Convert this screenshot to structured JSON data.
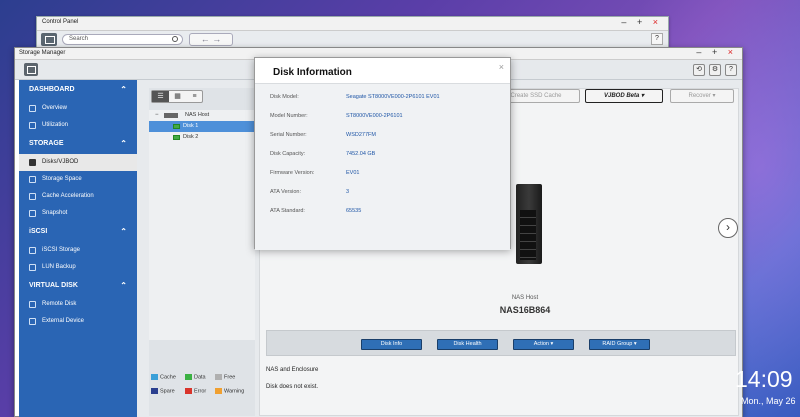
{
  "control_panel": {
    "title": "Control Panel",
    "window_controls": [
      "–",
      "+",
      "×"
    ],
    "search_placeholder": "Search",
    "nav_label": "←  →",
    "help_label": "?"
  },
  "storage_manager": {
    "title": "Storage Manager",
    "window_controls": [
      "–",
      "+",
      "×"
    ],
    "toolbar_buttons": [
      "⟲",
      "⚙",
      "?"
    ]
  },
  "sidebar": {
    "sections": [
      {
        "label": "DASHBOARD",
        "items": [
          "Overview",
          "Utilization"
        ]
      },
      {
        "label": "STORAGE",
        "items": [
          "Disks/VJBOD",
          "Storage Space",
          "Cache Acceleration",
          "Snapshot"
        ]
      },
      {
        "label": "iSCSI",
        "items": [
          "iSCSI Storage",
          "LUN Backup"
        ]
      },
      {
        "label": "VIRTUAL DISK",
        "items": [
          "Remote Disk",
          "External Device"
        ]
      }
    ],
    "active_item": "Disks/VJBOD",
    "chevron": "⌃"
  },
  "tree": {
    "view_buttons": [
      "☰",
      "▦",
      "≡"
    ],
    "host_label": "NAS Host",
    "disks": [
      "Disk 1",
      "Disk 2"
    ],
    "selected": "Disk 1",
    "expander": "−"
  },
  "legend": [
    {
      "label": "Cache",
      "color": "#3aa0d8"
    },
    {
      "label": "Data",
      "color": "#3bb143"
    },
    {
      "label": "Free",
      "color": "#b0b0b0"
    },
    {
      "label": "Spare",
      "color": "#2a3f8f"
    },
    {
      "label": "Error",
      "color": "#d9342b"
    },
    {
      "label": "Warning",
      "color": "#f0a030"
    }
  ],
  "top_buttons": {
    "ssd_cache": "Create SSD Cache",
    "vjbod": "VJBOD Beta ▾",
    "recover": "Recover ▾"
  },
  "nas": {
    "host_label": "NAS Host",
    "model": "NAS16B864",
    "next": "›"
  },
  "actions": [
    "Disk Info",
    "Disk Health",
    "Action ▾",
    "RAID Group ▾"
  ],
  "info": {
    "heading": "NAS and Enclosure",
    "message": "Disk does not exist."
  },
  "modal": {
    "title": "Disk Information",
    "close": "×",
    "rows": [
      {
        "label": "Disk Model:",
        "value": "Seagate ST8000VE000-2P6101 EV01"
      },
      {
        "label": "Model Number:",
        "value": "ST8000VE000-2P6101"
      },
      {
        "label": "Serial Number:",
        "value": "WSD277FM"
      },
      {
        "label": "Disk Capacity:",
        "value": "7452.04 GB"
      },
      {
        "label": "Firmware Version:",
        "value": "EV01"
      },
      {
        "label": "ATA Version:",
        "value": "3"
      },
      {
        "label": "ATA Standard:",
        "value": "65535"
      }
    ]
  },
  "clock": {
    "time": "14:09",
    "date": "Mon., May 26"
  }
}
